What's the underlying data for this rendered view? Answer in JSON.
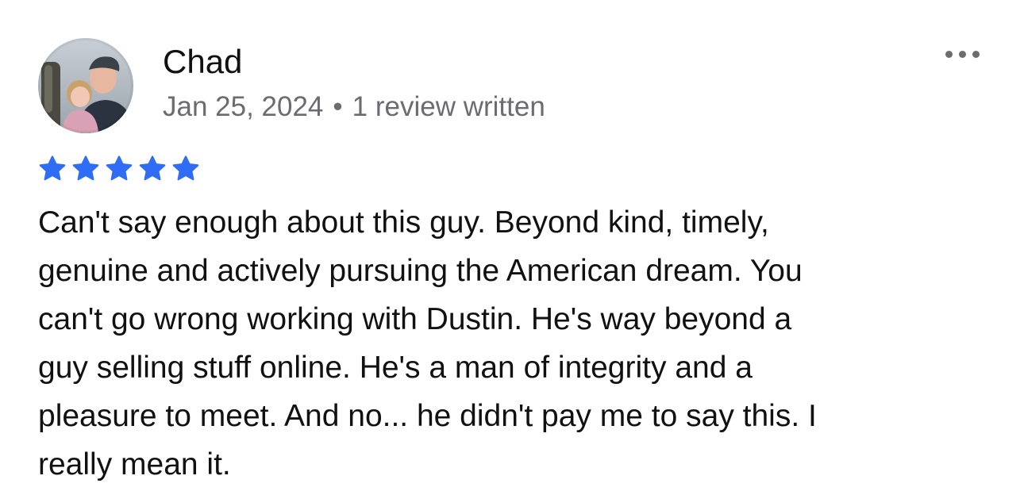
{
  "review": {
    "author": "Chad",
    "date": "Jan 25, 2024",
    "separator": "•",
    "reviews_written": "1 review written",
    "rating": 5,
    "rating_max": 5,
    "star_color": "#2f6df6",
    "body_lines": [
      "Can't say enough about this guy. Beyond kind, timely,",
      "genuine and actively pursuing the American dream. You",
      "can't go wrong working with Dustin. He's way beyond a",
      "guy selling stuff online. He's a man of integrity and a",
      "pleasure to meet. And no... he didn't pay me to say this. I",
      "really mean it."
    ]
  },
  "icons": {
    "avatar": "profile-photo",
    "more": "more-horizontal-icon",
    "star": "star-icon"
  }
}
